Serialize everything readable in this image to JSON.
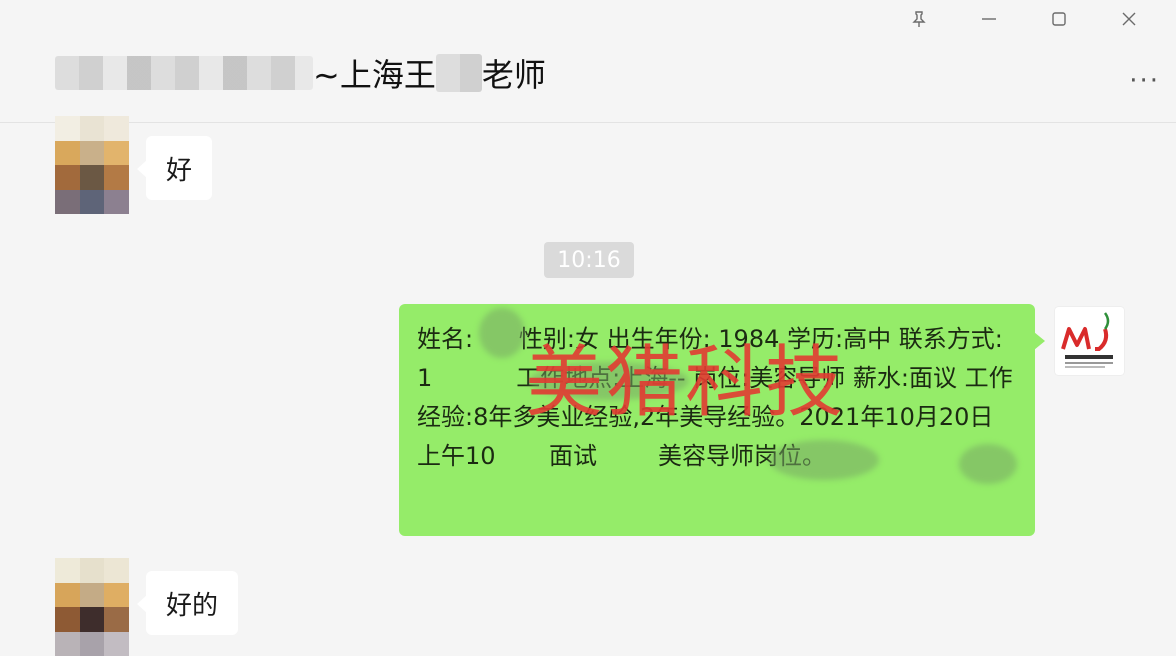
{
  "window": {
    "controls": {
      "pin": "pin-icon",
      "minimize": "minimize-icon",
      "maximize": "maximize-icon",
      "close": "close-icon"
    }
  },
  "chat": {
    "title": "~上海王",
    "title_suffix": "老师",
    "more_label": "···"
  },
  "messages": {
    "m1_text": "好",
    "time": "10:16",
    "m2_text": "姓名:      性别:女 出生年份: 1984 学历:高中 联系方式: 1           工作地点:上海-- 岗位:美容导师 薪水:面议 工作经验:8年多美业经验,2年美导经验。2021年10月20日上午10       面试        美容导师岗位。",
    "m3_text": "好的"
  },
  "watermark": {
    "text": "美猎科技"
  },
  "colors": {
    "sent_bubble": "#95ec69",
    "received_bubble": "#ffffff",
    "watermark": "#e23b32",
    "background": "#f5f5f5"
  }
}
